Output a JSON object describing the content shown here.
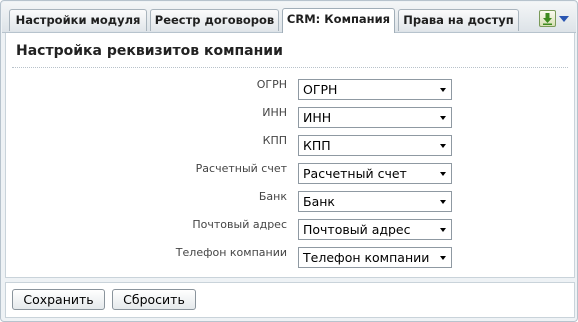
{
  "tabs": [
    {
      "label": "Настройки модуля",
      "active": false
    },
    {
      "label": "Реестр договоров",
      "active": false
    },
    {
      "label": "CRM: Компания",
      "active": true
    },
    {
      "label": "Права на доступ",
      "active": false
    }
  ],
  "toolbar": {
    "download_icon": "download-icon",
    "menu_icon": "chevron-down-icon",
    "accent_color": "#2a56b2"
  },
  "panel": {
    "title": "Настройка реквизитов компании"
  },
  "fields": [
    {
      "label": "ОГРН",
      "value": "ОГРН"
    },
    {
      "label": "ИНН",
      "value": "ИНН"
    },
    {
      "label": "КПП",
      "value": "КПП"
    },
    {
      "label": "Расчетный счет",
      "value": "Расчетный счет"
    },
    {
      "label": "Банк",
      "value": "Банк"
    },
    {
      "label": "Почтовый адрес",
      "value": "Почтовый адрес"
    },
    {
      "label": "Телефон компании",
      "value": "Телефон компании"
    }
  ],
  "footer": {
    "save_label": "Сохранить",
    "reset_label": "Сбросить"
  }
}
